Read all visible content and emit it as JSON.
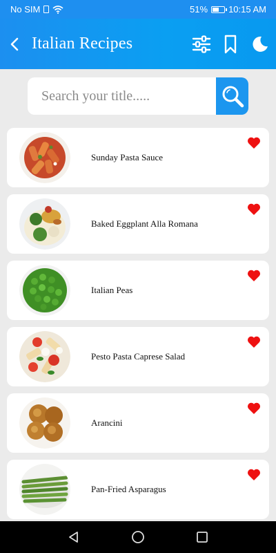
{
  "status_bar": {
    "carrier": "No SIM",
    "battery": "51%",
    "time": "10:15 AM"
  },
  "app_bar": {
    "title": "Italian Recipes",
    "back_icon": "chevron-left-icon",
    "actions": [
      "sliders-icon",
      "bookmark-icon",
      "moon-icon"
    ]
  },
  "search": {
    "placeholder": "Search your title.....",
    "value": "",
    "button_icon": "search-icon"
  },
  "recipes": [
    {
      "name": "Sunday Pasta Sauce",
      "favorite": true
    },
    {
      "name": "Baked Eggplant Alla Romana",
      "favorite": true
    },
    {
      "name": "Italian Peas",
      "favorite": true
    },
    {
      "name": "Pesto Pasta Caprese Salad",
      "favorite": true
    },
    {
      "name": "Arancini",
      "favorite": true
    },
    {
      "name": "Pan-Fried Asparagus",
      "favorite": true
    }
  ],
  "colors": {
    "accent": "#1e8ff0",
    "favorite": "#ee1111",
    "background": "#ebebeb"
  },
  "nav_bar": {
    "icons": [
      "back-triangle-icon",
      "home-circle-icon",
      "recents-square-icon"
    ]
  }
}
